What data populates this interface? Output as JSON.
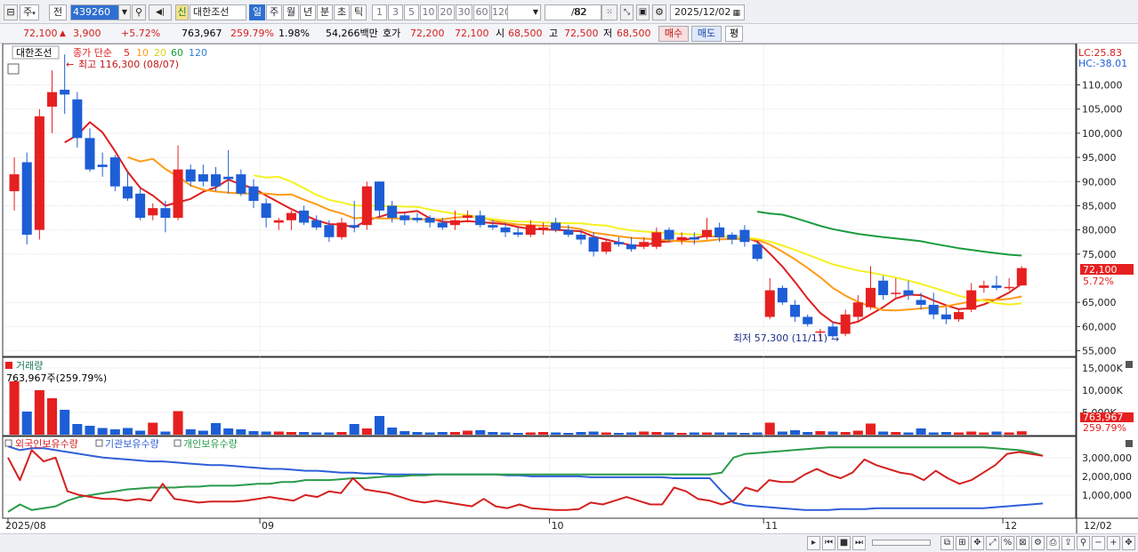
{
  "toolbar": {
    "market": "주",
    "prev": "전",
    "code": "439260",
    "stock_name": "대한조선",
    "badge": "신",
    "periods": [
      "일",
      "주",
      "월",
      "년",
      "분",
      "초",
      "틱"
    ],
    "active_period": "일",
    "minutes": [
      "1",
      "3",
      "5",
      "10",
      "20",
      "30",
      "60",
      "120"
    ],
    "count": "82",
    "count_total": "/82",
    "date": "2025/12/02"
  },
  "quote": {
    "price": "72,100",
    "change": "3,900",
    "change_pct": "+5.72%",
    "volume": "763,967",
    "volume_ratio": "259.79%",
    "turnover": "1.98%",
    "amount": "54,266백만",
    "bid_label": "호가",
    "ask_price": "72,200",
    "bid_price": "72,100",
    "open_label": "시",
    "open": "68,500",
    "high_label": "고",
    "high": "72,500",
    "low_label": "저",
    "low": "68,500",
    "buy_label": "매수",
    "sell_label": "매도",
    "eval_label": "평"
  },
  "legend": {
    "name": "대한조선",
    "ma_label": "종가 단순",
    "ma_periods": [
      "5",
      "10",
      "20",
      "60",
      "120"
    ],
    "ma_colors": [
      "#e01e1e",
      "#ff9b17",
      "#f5f11f",
      "#1a9b3e",
      "#2f7ddb"
    ],
    "lc_label": "LC:25.83",
    "hc_label": "HC:-38.01"
  },
  "annotations": {
    "high": "최고 116,300 (08/07)",
    "low": "최저 57,300 (11/11)"
  },
  "price_axis": {
    "ticks": [
      "110,000",
      "105,000",
      "100,000",
      "95,000",
      "90,000",
      "85,000",
      "80,000",
      "75,000",
      "65,000",
      "60,000",
      "55,000"
    ],
    "current_price": "72,100",
    "current_pct": "5.72%"
  },
  "volume_panel": {
    "title": "거래량",
    "value_label": "763,967주(259.79%)",
    "ticks": [
      "15,000K",
      "10,000K",
      "5,000K"
    ],
    "current_value": "763,967",
    "current_pct": "259.79%"
  },
  "holdings_panel": {
    "foreign_label": "외국인보유수량",
    "inst_label": "기관보유수량",
    "indiv_label": "개인보유수량",
    "foreign_color": "#d42020",
    "inst_color": "#2f5fd8",
    "indiv_color": "#2a9b4a",
    "ticks": [
      "3,000,000",
      "2,000,000",
      "1,000,000"
    ]
  },
  "date_axis": [
    "2025/08",
    "09",
    "10",
    "11",
    "12",
    "12/02"
  ],
  "colors": {
    "up": "#e62020",
    "down": "#1d5ed6",
    "accent": "#2f6fd0"
  },
  "chart_data": {
    "type": "candlestick",
    "price_range": [
      54000,
      118000
    ],
    "candles": [
      {
        "o": 88000,
        "h": 95000,
        "l": 84000,
        "c": 91500
      },
      {
        "o": 94000,
        "h": 96000,
        "l": 77000,
        "c": 79000
      },
      {
        "o": 80000,
        "h": 105000,
        "l": 78000,
        "c": 103500
      },
      {
        "o": 105500,
        "h": 113000,
        "l": 100000,
        "c": 108500
      },
      {
        "o": 109000,
        "h": 116300,
        "l": 104000,
        "c": 108000
      },
      {
        "o": 107000,
        "h": 108500,
        "l": 97000,
        "c": 99000
      },
      {
        "o": 99000,
        "h": 101000,
        "l": 92000,
        "c": 92500
      },
      {
        "o": 93500,
        "h": 96000,
        "l": 91000,
        "c": 93000
      },
      {
        "o": 95000,
        "h": 95500,
        "l": 88000,
        "c": 89000
      },
      {
        "o": 89000,
        "h": 92000,
        "l": 86000,
        "c": 86500
      },
      {
        "o": 87500,
        "h": 88500,
        "l": 82000,
        "c": 82500
      },
      {
        "o": 83000,
        "h": 85500,
        "l": 82000,
        "c": 84500
      },
      {
        "o": 84500,
        "h": 86000,
        "l": 79500,
        "c": 82500
      },
      {
        "o": 82500,
        "h": 97500,
        "l": 82000,
        "c": 92500
      },
      {
        "o": 92500,
        "h": 93500,
        "l": 89000,
        "c": 90000
      },
      {
        "o": 91500,
        "h": 93500,
        "l": 89000,
        "c": 90000
      },
      {
        "o": 91500,
        "h": 93000,
        "l": 88000,
        "c": 89000
      },
      {
        "o": 91000,
        "h": 96500,
        "l": 87500,
        "c": 90500
      },
      {
        "o": 91500,
        "h": 92500,
        "l": 87000,
        "c": 87500
      },
      {
        "o": 89000,
        "h": 90500,
        "l": 84500,
        "c": 86000
      },
      {
        "o": 85500,
        "h": 86500,
        "l": 80500,
        "c": 82500
      },
      {
        "o": 81500,
        "h": 82500,
        "l": 80000,
        "c": 82000
      },
      {
        "o": 82000,
        "h": 84000,
        "l": 80000,
        "c": 83500
      },
      {
        "o": 84000,
        "h": 85000,
        "l": 81000,
        "c": 81500
      },
      {
        "o": 82000,
        "h": 83000,
        "l": 80000,
        "c": 80500
      },
      {
        "o": 81000,
        "h": 82000,
        "l": 77500,
        "c": 78500
      },
      {
        "o": 78500,
        "h": 82500,
        "l": 78000,
        "c": 81500
      },
      {
        "o": 81000,
        "h": 86000,
        "l": 79500,
        "c": 80500
      },
      {
        "o": 81000,
        "h": 90000,
        "l": 80000,
        "c": 89000
      },
      {
        "o": 90000,
        "h": 90000,
        "l": 82500,
        "c": 84000
      },
      {
        "o": 85000,
        "h": 86000,
        "l": 81500,
        "c": 82500
      },
      {
        "o": 83000,
        "h": 83500,
        "l": 81000,
        "c": 82000
      },
      {
        "o": 82500,
        "h": 83500,
        "l": 81500,
        "c": 82000
      },
      {
        "o": 82500,
        "h": 83000,
        "l": 80500,
        "c": 81500
      },
      {
        "o": 81500,
        "h": 82500,
        "l": 80000,
        "c": 80500
      },
      {
        "o": 81000,
        "h": 84000,
        "l": 80000,
        "c": 82000
      },
      {
        "o": 82500,
        "h": 84000,
        "l": 81500,
        "c": 83000
      },
      {
        "o": 83000,
        "h": 84000,
        "l": 80500,
        "c": 81000
      },
      {
        "o": 81000,
        "h": 82000,
        "l": 80000,
        "c": 80500
      },
      {
        "o": 80500,
        "h": 81500,
        "l": 78500,
        "c": 79500
      },
      {
        "o": 79500,
        "h": 80500,
        "l": 78500,
        "c": 79000
      },
      {
        "o": 79000,
        "h": 82000,
        "l": 78500,
        "c": 81000
      },
      {
        "o": 80500,
        "h": 81500,
        "l": 79000,
        "c": 80500
      },
      {
        "o": 81500,
        "h": 82500,
        "l": 79500,
        "c": 80000
      },
      {
        "o": 80000,
        "h": 81000,
        "l": 78500,
        "c": 79000
      },
      {
        "o": 79000,
        "h": 80000,
        "l": 77000,
        "c": 78000
      },
      {
        "o": 78500,
        "h": 79500,
        "l": 74500,
        "c": 75500
      },
      {
        "o": 75500,
        "h": 78000,
        "l": 75000,
        "c": 77500
      },
      {
        "o": 77500,
        "h": 78500,
        "l": 76500,
        "c": 77000
      },
      {
        "o": 77000,
        "h": 78500,
        "l": 75500,
        "c": 76000
      },
      {
        "o": 76500,
        "h": 78500,
        "l": 76000,
        "c": 77500
      },
      {
        "o": 76500,
        "h": 80500,
        "l": 76000,
        "c": 79500
      },
      {
        "o": 80000,
        "h": 80500,
        "l": 77500,
        "c": 78000
      },
      {
        "o": 78000,
        "h": 79500,
        "l": 77000,
        "c": 78500
      },
      {
        "o": 78500,
        "h": 79500,
        "l": 77000,
        "c": 78000
      },
      {
        "o": 78500,
        "h": 82500,
        "l": 78000,
        "c": 80000
      },
      {
        "o": 80500,
        "h": 81500,
        "l": 77500,
        "c": 78500
      },
      {
        "o": 79000,
        "h": 79500,
        "l": 77000,
        "c": 78000
      },
      {
        "o": 80000,
        "h": 81000,
        "l": 76500,
        "c": 77500
      },
      {
        "o": 77000,
        "h": 77500,
        "l": 73500,
        "c": 74000
      },
      {
        "o": 62000,
        "h": 70000,
        "l": 61500,
        "c": 67500
      },
      {
        "o": 68000,
        "h": 68500,
        "l": 64500,
        "c": 65000
      },
      {
        "o": 64500,
        "h": 65500,
        "l": 61000,
        "c": 62000
      },
      {
        "o": 62000,
        "h": 62500,
        "l": 60000,
        "c": 60500
      },
      {
        "o": 59000,
        "h": 59500,
        "l": 57300,
        "c": 59000
      },
      {
        "o": 60000,
        "h": 61000,
        "l": 57500,
        "c": 58000
      },
      {
        "o": 58500,
        "h": 63500,
        "l": 58000,
        "c": 62500
      },
      {
        "o": 62000,
        "h": 66500,
        "l": 61000,
        "c": 65000
      },
      {
        "o": 64000,
        "h": 72500,
        "l": 63500,
        "c": 68000
      },
      {
        "o": 69500,
        "h": 70500,
        "l": 65500,
        "c": 66500
      },
      {
        "o": 67000,
        "h": 70000,
        "l": 66000,
        "c": 67000
      },
      {
        "o": 67500,
        "h": 69500,
        "l": 65500,
        "c": 66500
      },
      {
        "o": 65500,
        "h": 67000,
        "l": 63500,
        "c": 64500
      },
      {
        "o": 64500,
        "h": 67000,
        "l": 61500,
        "c": 62500
      },
      {
        "o": 62500,
        "h": 64000,
        "l": 60500,
        "c": 61500
      },
      {
        "o": 61500,
        "h": 63500,
        "l": 61000,
        "c": 63000
      },
      {
        "o": 63500,
        "h": 69000,
        "l": 63000,
        "c": 67500
      },
      {
        "o": 68000,
        "h": 69500,
        "l": 67000,
        "c": 68500
      },
      {
        "o": 68500,
        "h": 70500,
        "l": 67500,
        "c": 68000
      },
      {
        "o": 68200,
        "h": 70000,
        "l": 67500,
        "c": 68200
      },
      {
        "o": 68500,
        "h": 72500,
        "l": 68500,
        "c": 72100
      }
    ],
    "volume_range": [
      0,
      16000000
    ],
    "volume": [
      12000000,
      5200000,
      10000000,
      8200000,
      5600000,
      2400000,
      2000000,
      1500000,
      1200000,
      1500000,
      900000,
      2700000,
      700000,
      5300000,
      1200000,
      900000,
      2600000,
      1400000,
      1200000,
      800000,
      700000,
      700000,
      600000,
      600000,
      500000,
      500000,
      600000,
      2400000,
      1400000,
      4200000,
      1600000,
      800000,
      600000,
      500000,
      600000,
      600000,
      900000,
      1000000,
      600000,
      500000,
      400000,
      500000,
      600000,
      500000,
      400000,
      600000,
      700000,
      500000,
      400000,
      500000,
      700000,
      600000,
      500000,
      400000,
      500000,
      500000,
      500000,
      500000,
      400000,
      500000,
      2700000,
      700000,
      1000000,
      600000,
      800000,
      700000,
      600000,
      900000,
      2500000,
      700000,
      600000,
      500000,
      1400000,
      500000,
      600000,
      500000,
      700000,
      500000,
      700000,
      500000,
      763967
    ],
    "holdings_range": [
      0,
      3800000
    ],
    "foreign_holdings": [
      3000000,
      1800000,
      3400000,
      2800000,
      3000000,
      1200000,
      1000000,
      900000,
      800000,
      800000,
      700000,
      800000,
      700000,
      1600000,
      800000,
      700000,
      600000,
      650000,
      650000,
      650000,
      700000,
      800000,
      900000,
      800000,
      700000,
      1000000,
      900000,
      1200000,
      1100000,
      1900000,
      1300000,
      1200000,
      1100000,
      900000,
      700000,
      600000,
      700000,
      600000,
      500000,
      400000,
      800000,
      400000,
      300000,
      500000,
      300000,
      250000,
      200000,
      200000,
      250000,
      600000,
      500000,
      700000,
      900000,
      700000,
      500000,
      500000,
      1400000,
      1200000,
      800000,
      700000,
      500000,
      700000,
      1400000,
      1200000,
      1800000,
      1700000,
      1700000,
      2100000,
      2400000,
      2100000,
      1900000,
      2200000,
      2900000,
      2600000,
      2400000,
      2200000,
      2100000,
      1800000,
      2300000,
      1900000,
      1600000,
      1800000,
      2200000,
      2600000,
      3200000,
      3300000,
      3200000,
      3100000
    ],
    "institution_holdings": [
      3600000,
      3400000,
      3500000,
      3500000,
      3400000,
      3300000,
      3200000,
      3100000,
      3000000,
      2950000,
      2900000,
      2850000,
      2800000,
      2800000,
      2750000,
      2700000,
      2650000,
      2600000,
      2600000,
      2550000,
      2500000,
      2450000,
      2400000,
      2400000,
      2350000,
      2300000,
      2300000,
      2250000,
      2200000,
      2200000,
      2150000,
      2150000,
      2100000,
      2100000,
      2100000,
      2100000,
      2100000,
      2100000,
      2100000,
      2100000,
      2100000,
      2100000,
      2050000,
      2050000,
      2000000,
      2000000,
      2000000,
      2000000,
      2000000,
      1950000,
      1950000,
      1950000,
      1950000,
      1950000,
      1950000,
      1950000,
      1900000,
      1900000,
      1900000,
      1900000,
      1200000,
      600000,
      450000,
      400000,
      350000,
      300000,
      250000,
      200000,
      200000,
      200000,
      250000,
      250000,
      250000,
      300000,
      300000,
      300000,
      300000,
      300000,
      300000,
      300000,
      300000,
      300000,
      300000,
      350000,
      400000,
      450000,
      500000,
      550000
    ],
    "individual_holdings": [
      100000,
      500000,
      200000,
      300000,
      400000,
      700000,
      900000,
      1000000,
      1100000,
      1200000,
      1300000,
      1350000,
      1400000,
      1400000,
      1400000,
      1450000,
      1450000,
      1500000,
      1500000,
      1500000,
      1550000,
      1600000,
      1600000,
      1700000,
      1700000,
      1800000,
      1800000,
      1800000,
      1850000,
      1900000,
      1900000,
      1950000,
      2000000,
      2000000,
      2050000,
      2050000,
      2100000,
      2100000,
      2100000,
      2100000,
      2100000,
      2100000,
      2100000,
      2100000,
      2100000,
      2100000,
      2100000,
      2100000,
      2100000,
      2100000,
      2100000,
      2100000,
      2100000,
      2100000,
      2100000,
      2100000,
      2100000,
      2100000,
      2100000,
      2100000,
      2200000,
      3000000,
      3200000,
      3250000,
      3300000,
      3350000,
      3400000,
      3450000,
      3500000,
      3550000,
      3550000,
      3550000,
      3550000,
      3550000,
      3550000,
      3550000,
      3550000,
      3550000,
      3550000,
      3550000,
      3550000,
      3550000,
      3550000,
      3500000,
      3450000,
      3400000,
      3300000,
      3100000
    ]
  }
}
